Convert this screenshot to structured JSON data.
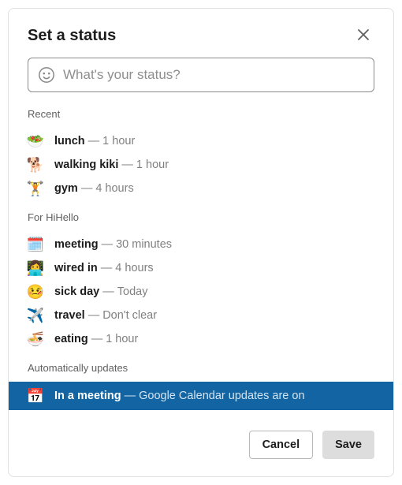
{
  "title": "Set a status",
  "input": {
    "placeholder": "What's your status?"
  },
  "sections": {
    "recent": {
      "heading": "Recent",
      "items": [
        {
          "emoji": "🥗",
          "label": "lunch",
          "sep": "—",
          "duration": "1 hour"
        },
        {
          "emoji": "🐕",
          "label": "walking kiki",
          "sep": "—",
          "duration": "1 hour"
        },
        {
          "emoji": "🏋️",
          "label": "gym",
          "sep": "—",
          "duration": "4 hours"
        }
      ]
    },
    "workspace": {
      "heading": "For HiHello",
      "items": [
        {
          "emoji": "🗓️",
          "label": "meeting",
          "sep": "—",
          "duration": "30 minutes"
        },
        {
          "emoji": "👩‍💻",
          "label": "wired in",
          "sep": "—",
          "duration": "4 hours"
        },
        {
          "emoji": "🤒",
          "label": "sick day",
          "sep": "—",
          "duration": "Today"
        },
        {
          "emoji": "✈️",
          "label": "travel",
          "sep": "—",
          "duration": "Don't clear"
        },
        {
          "emoji": "🍜",
          "label": "eating",
          "sep": "—",
          "duration": "1 hour"
        }
      ]
    },
    "auto": {
      "heading": "Automatically updates",
      "item": {
        "emoji": "📅",
        "label": "In a meeting",
        "sep": "—",
        "duration": "Google Calendar updates are on"
      }
    }
  },
  "buttons": {
    "cancel": "Cancel",
    "save": "Save"
  }
}
